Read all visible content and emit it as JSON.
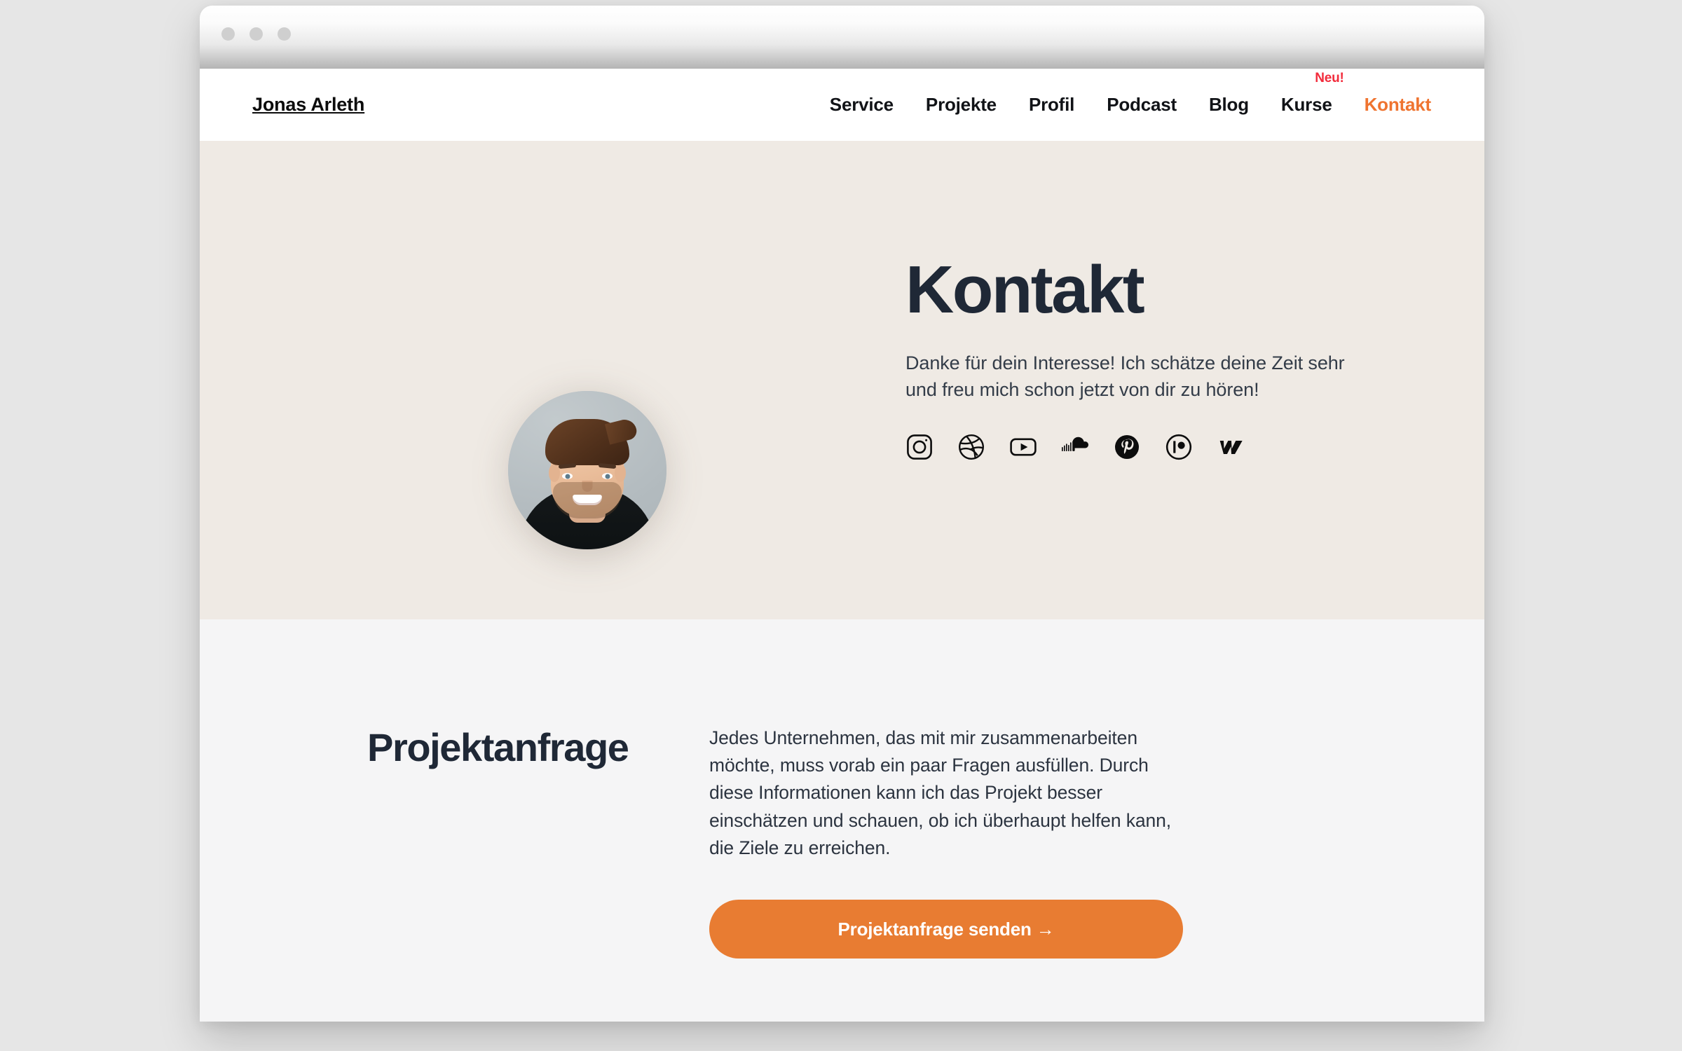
{
  "window": {
    "dots": [
      "window-dot-1",
      "window-dot-2",
      "window-dot-3"
    ]
  },
  "nav": {
    "brand": "Jonas Arleth",
    "links": [
      {
        "label": "Service",
        "active": false,
        "badge": ""
      },
      {
        "label": "Projekte",
        "active": false,
        "badge": ""
      },
      {
        "label": "Profil",
        "active": false,
        "badge": ""
      },
      {
        "label": "Podcast",
        "active": false,
        "badge": ""
      },
      {
        "label": "Blog",
        "active": false,
        "badge": ""
      },
      {
        "label": "Kurse",
        "active": false,
        "badge": "Neu!"
      },
      {
        "label": "Kontakt",
        "active": true,
        "badge": ""
      }
    ]
  },
  "hero": {
    "avatar_alt": "Portrait Jonas Arleth",
    "title": "Kontakt",
    "subtitle": "Danke für dein Interesse! Ich schätze deine Zeit sehr und freu mich schon jetzt von dir zu hören!",
    "socials": [
      {
        "name": "instagram-icon",
        "label": "Instagram"
      },
      {
        "name": "dribbble-icon",
        "label": "Dribbble"
      },
      {
        "name": "youtube-icon",
        "label": "YouTube"
      },
      {
        "name": "soundcloud-icon",
        "label": "SoundCloud"
      },
      {
        "name": "pinterest-icon",
        "label": "Pinterest"
      },
      {
        "name": "patreon-icon",
        "label": "Patreon"
      },
      {
        "name": "webflow-icon",
        "label": "Webflow"
      }
    ]
  },
  "request": {
    "title": "Projektanfrage",
    "text": "Jedes Unternehmen, das mit mir zusammenarbeiten möchte, muss vorab ein paar Fragen ausfüllen. Durch diese Informationen kann ich das Projekt besser einschätzen und schauen, ob ich überhaupt helfen kann, die Ziele zu erreichen.",
    "cta_label": "Projektanfrage senden →"
  },
  "colors": {
    "accent_orange": "#e87c32",
    "nav_active": "#ef7430",
    "badge_red": "#f22c3c",
    "heading_navy": "#1f2836",
    "hero_bg": "#efeae4",
    "section_bg": "#f5f5f6",
    "page_bg": "#e6e6e6"
  }
}
